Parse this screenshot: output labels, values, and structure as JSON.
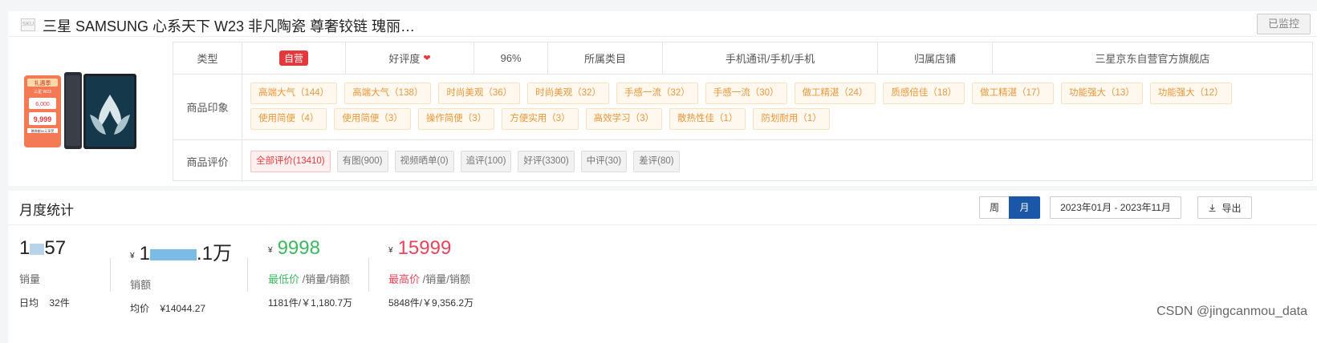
{
  "product": {
    "title": "三星 SAMSUNG 心系天下 W23 非凡陶瓷 尊奢铰链 瑰丽…",
    "icon_text": "SKU",
    "monitor_label": "已监控",
    "image_promo": {
      "line1": "礼遇季",
      "line2": "三星 W23",
      "price_old": "6,000",
      "price": "9,999",
      "note": "赠券额50元享受"
    }
  },
  "info_row": {
    "type_label": "类型",
    "type_value": "自营",
    "rating_label": "好评度",
    "rating_value": "96%",
    "category_label": "所属类目",
    "category_value": "手机通讯/手机/手机",
    "store_label": "归属店铺",
    "store_value": "三星京东自营官方旗舰店"
  },
  "impressions": {
    "label": "商品印象",
    "tags": [
      "高端大气（144）",
      "高端大气（138）",
      "时尚美观（36）",
      "时尚美观（32）",
      "手感一流（32）",
      "手感一流（30）",
      "做工精湛（24）",
      "质感倍佳（18）",
      "做工精湛（17）",
      "功能强大（13）",
      "功能强大（12）",
      "使用简便（4）",
      "使用简便（3）",
      "操作简便（3）",
      "方便实用（3）",
      "高效学习（3）",
      "散热性佳（1）",
      "防划耐用（1）"
    ]
  },
  "reviews": {
    "label": "商品评价",
    "items": [
      "全部评价(13410)",
      "有图(900)",
      "视频晒单(0)",
      "追评(100)",
      "好评(3300)",
      "中评(30)",
      "差评(80)"
    ]
  },
  "monthly": {
    "title": "月度统计",
    "week_label": "周",
    "month_label": "月",
    "date_range": "2023年01月 - 2023年11月",
    "export_label": "导出",
    "sales": {
      "value_prefix": "1",
      "value_suffix": "57",
      "label": "销量",
      "daily_label": "日均",
      "daily_value": "32件"
    },
    "revenue": {
      "currency": "¥",
      "value_prefix": "1",
      "value_suffix": ".1万",
      "label": "销额",
      "avg_label": "均价",
      "avg_value": "¥14044.27"
    },
    "lowest": {
      "currency": "¥",
      "value": "9998",
      "label": "最低价",
      "label_suffix": "/销量/销额",
      "detail": "1181件/￥1,180.7万"
    },
    "highest": {
      "currency": "¥",
      "value": "15999",
      "label": "最高价",
      "label_suffix": "/销量/销额",
      "detail": "5848件/￥9,356.2万"
    }
  },
  "watermark": "CSDN @jingcanmou_data"
}
